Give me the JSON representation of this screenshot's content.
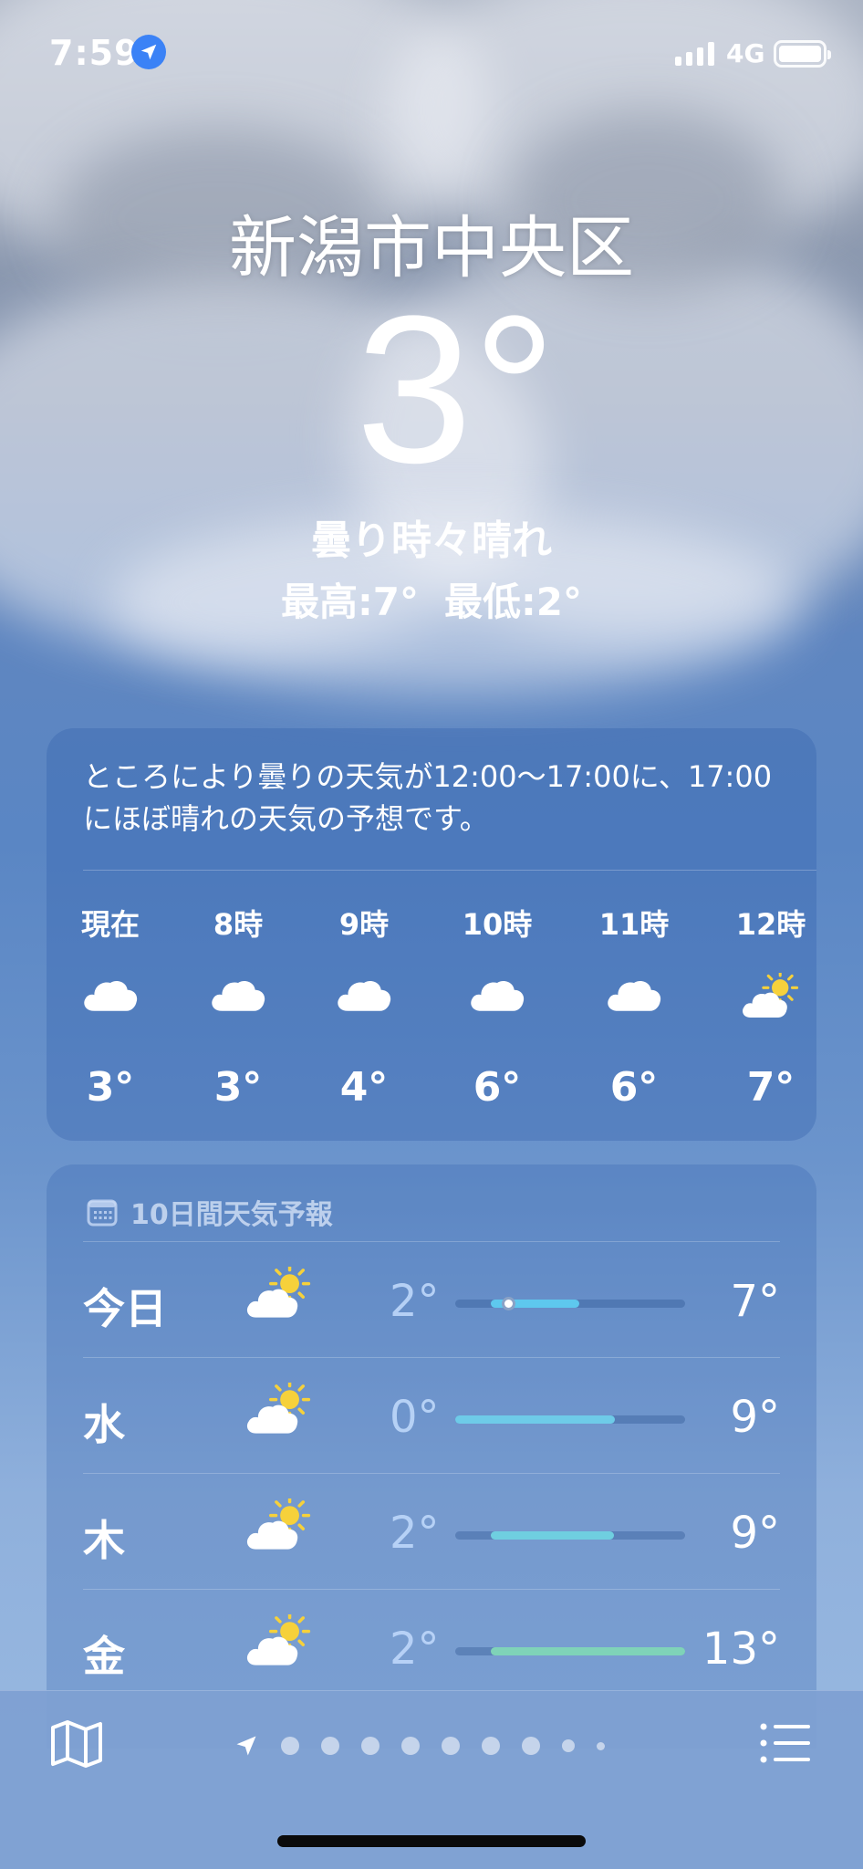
{
  "status_bar": {
    "time": "7:59",
    "network": "4G"
  },
  "header": {
    "city": "新潟市中央区",
    "temperature": "3°",
    "condition": "曇り時々晴れ",
    "high": "最高:7°",
    "low": "最低:2°"
  },
  "hourly": {
    "summary": "ところにより曇りの天気が12:00〜17:00に、17:00にほぼ晴れの天気の予想です。",
    "items": [
      {
        "label": "現在",
        "icon": "cloud-icon",
        "temp": "3°"
      },
      {
        "label": "8時",
        "icon": "cloud-icon",
        "temp": "3°"
      },
      {
        "label": "9時",
        "icon": "cloud-icon",
        "temp": "4°"
      },
      {
        "label": "10時",
        "icon": "cloud-icon",
        "temp": "6°"
      },
      {
        "label": "11時",
        "icon": "cloud-icon",
        "temp": "6°"
      },
      {
        "label": "12時",
        "icon": "partly-sunny-icon",
        "temp": "7°"
      }
    ]
  },
  "daily": {
    "title": "10日間天気予報",
    "range": {
      "min": 0,
      "max": 13
    },
    "days": [
      {
        "name": "今日",
        "icon": "partly-sunny-icon",
        "low": "2°",
        "high": "7°",
        "low_val": 2,
        "high_val": 7,
        "current_val": 3,
        "color": "#5ec8ee"
      },
      {
        "name": "水",
        "icon": "partly-sunny-icon",
        "low": "0°",
        "high": "9°",
        "low_val": 0,
        "high_val": 9,
        "color": "#6ecbe8"
      },
      {
        "name": "木",
        "icon": "partly-sunny-icon",
        "low": "2°",
        "high": "9°",
        "low_val": 2,
        "high_val": 9,
        "color": "#6fcfe0"
      },
      {
        "name": "金",
        "icon": "partly-sunny-icon",
        "low": "2°",
        "high": "13°",
        "low_val": 2,
        "high_val": 13,
        "color": "#7fd3b8"
      }
    ]
  },
  "colors": {
    "location_blue": "#3b82f6",
    "sun_yellow": "#f6d13b"
  }
}
